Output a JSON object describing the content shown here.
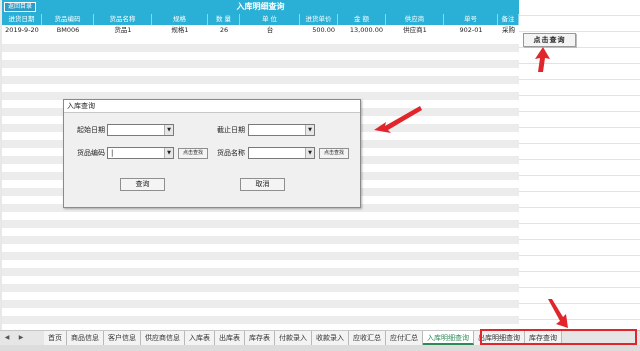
{
  "sheet": {
    "banner_title": "入库明细查询",
    "return_button": "返回目录",
    "columns": [
      "进货日期",
      "货品编码",
      "货品名称",
      "规格",
      "数 量",
      "单 位",
      "进货单价",
      "金 额",
      "供应商",
      "单号",
      "备注"
    ],
    "rows": [
      [
        "2019-9-20",
        "BM006",
        "货品1",
        "规格1",
        "26",
        "台",
        "500.00",
        "13,000.00",
        "供应商1",
        "902-01",
        "采购"
      ]
    ],
    "query_button": "点击查询"
  },
  "dialog": {
    "title": "入库查询",
    "start_date_label": "起始日期",
    "start_date_value": "",
    "end_date_label": "截止日期",
    "end_date_value": "",
    "product_code_label": "货品编码",
    "product_code_value": "|",
    "product_name_label": "货品名称",
    "product_name_value": "",
    "select_button_1": "点击查找",
    "select_button_2": "点击查找",
    "query_button": "查询",
    "cancel_button": "取消",
    "dropdown_icon": "chevron-down-icon"
  },
  "tabs": [
    "首页",
    "商品信息",
    "客户信息",
    "供应商信息",
    "入库表",
    "出库表",
    "库存表",
    "付款录入",
    "收款录入",
    "应收汇总",
    "应付汇总",
    "入库明细查询",
    "出库明细查询",
    "库存查询"
  ],
  "active_tab": "入库明细查询",
  "colors": {
    "header": "#2ab0d6",
    "annotation_red": "#e0262b",
    "active_tab_text": "#2e8b57"
  }
}
